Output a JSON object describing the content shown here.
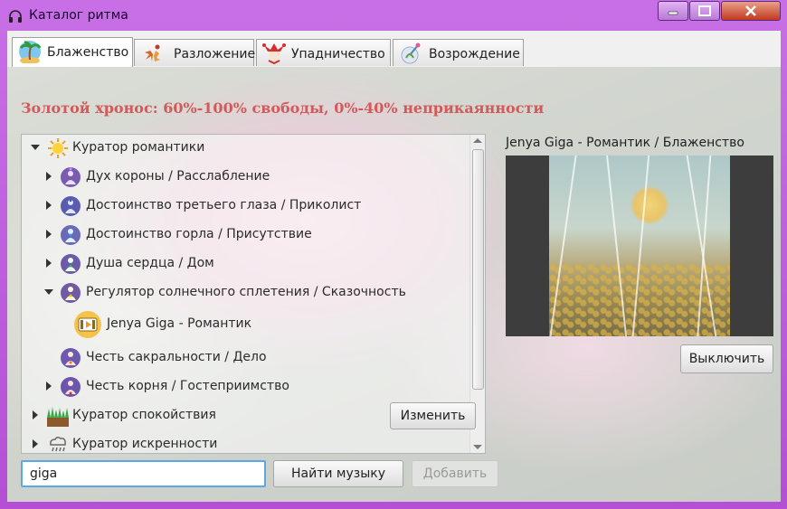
{
  "window": {
    "title": "Каталог ритма"
  },
  "tabs": [
    {
      "label": "Блаженство",
      "active": true,
      "icon": "palm-tree-icon"
    },
    {
      "label": "Разложение",
      "active": false,
      "icon": "autumn-leaves-icon"
    },
    {
      "label": "Упадничество",
      "active": false,
      "icon": "jester-icon"
    },
    {
      "label": "Возрождение",
      "active": false,
      "icon": "spring-icon"
    }
  ],
  "headline": "Золотой хронос: 60%-100% свободы, 0%-40% неприкаянности",
  "tree": {
    "nodes": [
      {
        "label": "Куратор романтики",
        "state": "expanded",
        "icon": "sun-icon"
      },
      {
        "label": "Дух короны / Расслабление",
        "state": "collapsed",
        "icon": "chakra-crown-icon"
      },
      {
        "label": "Достоинство третьего глаза / Приколист",
        "state": "collapsed",
        "icon": "chakra-third-eye-icon"
      },
      {
        "label": "Достоинство горла / Присутствие",
        "state": "collapsed",
        "icon": "chakra-throat-icon"
      },
      {
        "label": "Душа сердца / Дом",
        "state": "collapsed",
        "icon": "chakra-heart-icon"
      },
      {
        "label": "Регулятор солнечного сплетения / Сказочность",
        "state": "expanded",
        "icon": "chakra-solar-plexus-icon"
      },
      {
        "label": "Jenya Giga - Романтик",
        "state": "leaf",
        "icon": "music-video-icon"
      },
      {
        "label": "Честь сакральности / Дело",
        "state": "none",
        "icon": "chakra-sacral-icon"
      },
      {
        "label": "Честь корня / Гостеприимство",
        "state": "collapsed",
        "icon": "chakra-root-icon"
      },
      {
        "label": "Куратор спокойствия",
        "state": "collapsed",
        "icon": "grass-icon"
      },
      {
        "label": "Куратор искренности",
        "state": "collapsed",
        "icon": "rain-cloud-icon"
      }
    ]
  },
  "buttons": {
    "edit": "Изменить",
    "find": "Найти музыку",
    "add": "Добавить",
    "disable": "Выключить"
  },
  "search": {
    "value": "giga"
  },
  "preview": {
    "title": "Jenya Giga - Романтик / Блаженство"
  }
}
